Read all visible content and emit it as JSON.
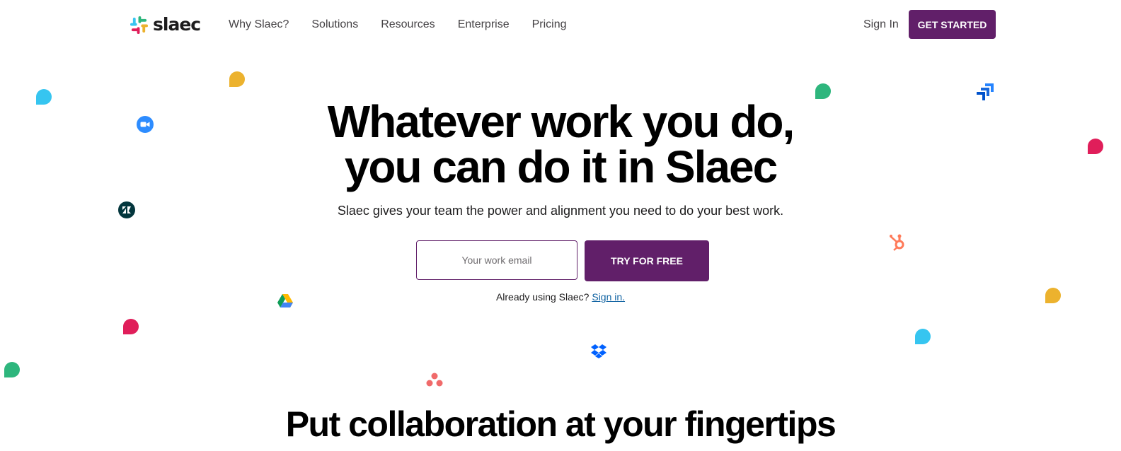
{
  "header": {
    "logo_text": "slaec",
    "nav": [
      {
        "label": "Why Slaec?"
      },
      {
        "label": "Solutions"
      },
      {
        "label": "Resources"
      },
      {
        "label": "Enterprise"
      },
      {
        "label": "Pricing"
      }
    ],
    "sign_in_label": "Sign In",
    "get_started_label": "GET STARTED"
  },
  "hero": {
    "title_line1": "Whatever work you do,",
    "title_line2": "you can do it in Slaec",
    "subtitle": "Slaec gives your team the power and alignment you need to do your best work.",
    "email_placeholder": "Your work email",
    "try_label": "TRY FOR FREE",
    "already_text": "Already using Slaec?",
    "sign_in_link": "Sign in."
  },
  "section": {
    "title": "Put collaboration at your fingertips"
  },
  "colors": {
    "primary": "#611f69",
    "link": "#1264a3",
    "slack_blue": "#36c5f0",
    "slack_green": "#2eb67d",
    "slack_red": "#e01e5a",
    "slack_yellow": "#ecb22e"
  },
  "floating_icons": [
    "yellow-bubble-icon",
    "blue-bubble-icon",
    "zoom-icon",
    "zendesk-icon",
    "google-drive-icon",
    "red-bubble-icon",
    "green-bubble-icon",
    "asana-icon",
    "dropbox-icon",
    "green-bubble-icon",
    "jira-icon",
    "red-bubble-icon",
    "hubspot-icon",
    "yellow-bubble-icon",
    "blue-bubble-icon"
  ]
}
